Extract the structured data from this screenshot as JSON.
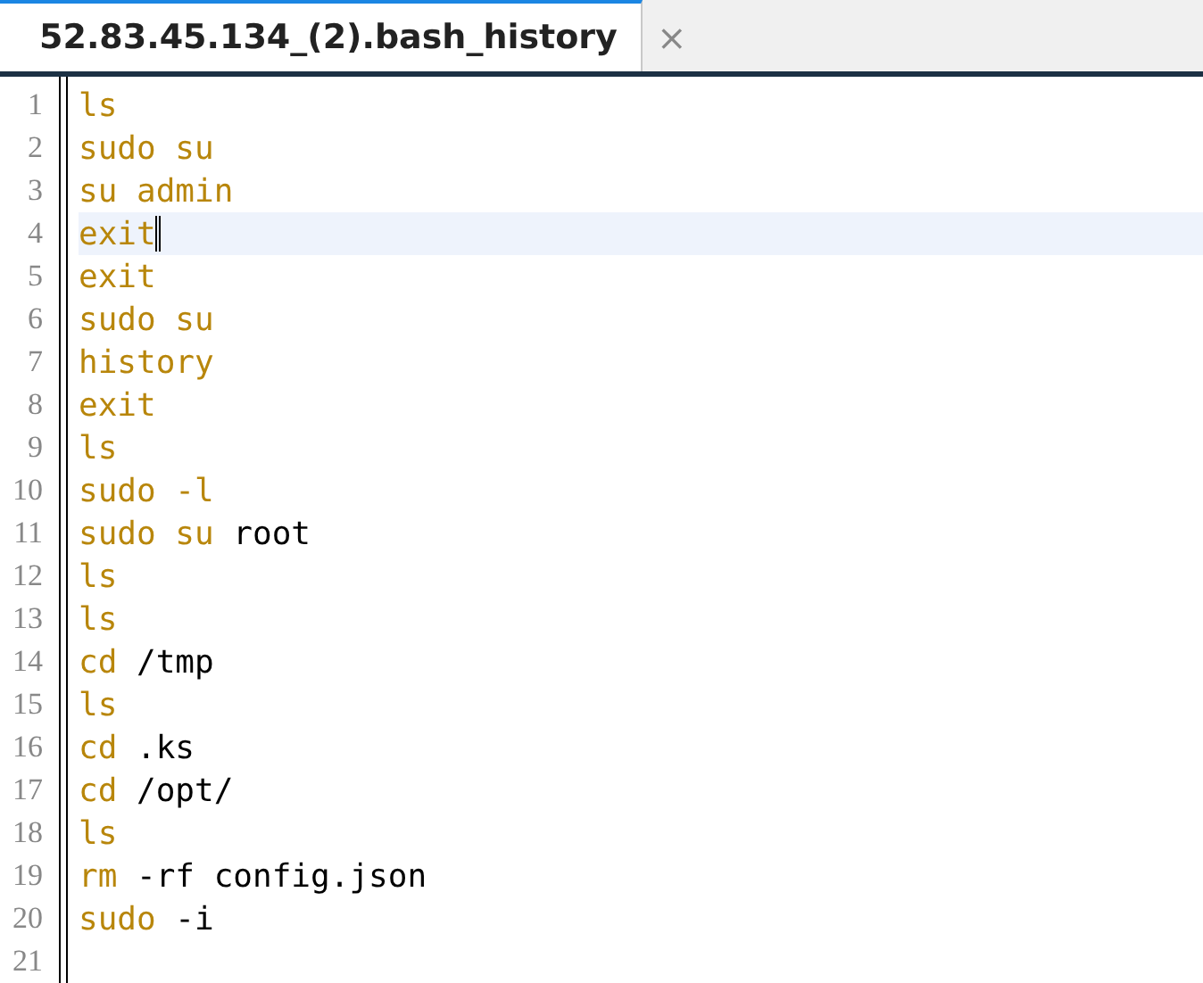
{
  "tab": {
    "title": "52.83.45.134_(2).bash_history",
    "close": "×",
    "selected": true
  },
  "lines": [
    {
      "number": "1",
      "command": "ls",
      "current": false
    },
    {
      "number": "2",
      "command": "sudo su",
      "current": false
    },
    {
      "number": "3",
      "command": "su admin",
      "current": false
    },
    {
      "number": "4",
      "command": "exit",
      "current": true
    },
    {
      "number": "5",
      "command": "exit",
      "current": false
    },
    {
      "number": "6",
      "command": "sudo su",
      "current": false
    },
    {
      "number": "7",
      "command": "history",
      "current": false
    },
    {
      "number": "8",
      "command": "exit",
      "current": false
    },
    {
      "number": "9",
      "command": "ls",
      "current": false
    },
    {
      "number": "10",
      "command": "sudo -l",
      "current": false
    },
    {
      "number": "11",
      "command": "sudo su",
      "args": "root",
      "current": false
    },
    {
      "number": "12",
      "command": "ls",
      "current": false
    },
    {
      "number": "13",
      "command": "ls",
      "current": false
    },
    {
      "number": "14",
      "command": "cd",
      "args": "/tmp",
      "current": false
    },
    {
      "number": "15",
      "command": "ls",
      "current": false
    },
    {
      "number": "16",
      "command": "cd",
      "args": ".ks",
      "current": false
    },
    {
      "number": "17",
      "command": "cd",
      "args": "/opt/",
      "current": false
    },
    {
      "number": "18",
      "command": "ls",
      "current": false
    },
    {
      "number": "19",
      "command": "rm",
      "args": "-rf config.json",
      "current": false
    },
    {
      "number": "20",
      "command": "sudo",
      "args": "-i",
      "current": false
    },
    {
      "number": "21",
      "current": false
    }
  ]
}
